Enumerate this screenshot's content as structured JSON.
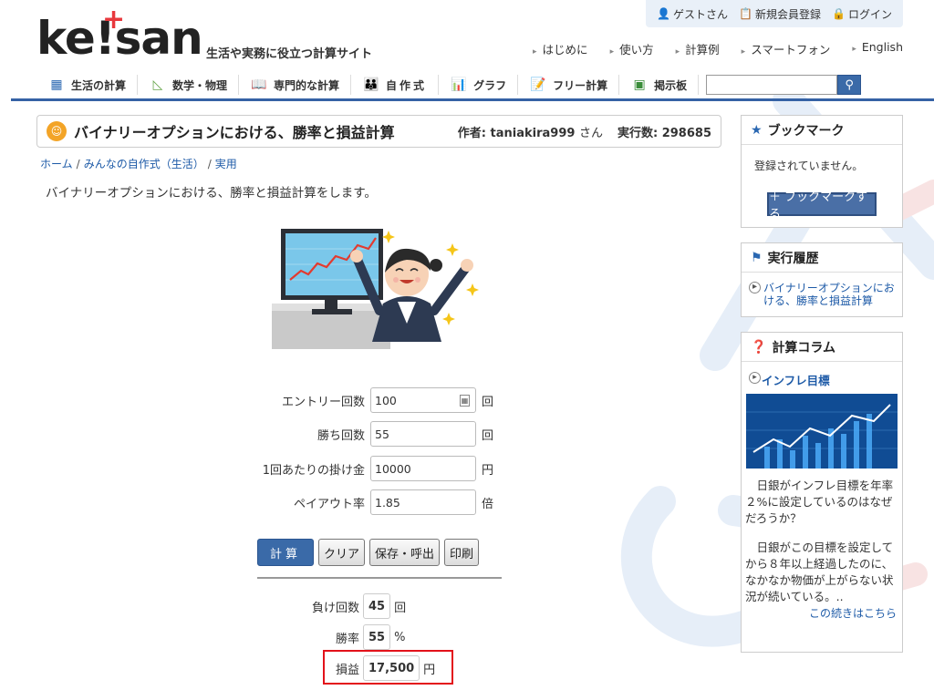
{
  "site": {
    "logo": "ke!san",
    "tagline": "生活や実務に役立つ計算サイト"
  },
  "account": {
    "guest": "ゲストさん",
    "register": "新規会員登録",
    "login": "ログイン"
  },
  "topnav": [
    "はじめに",
    "使い方",
    "計算例",
    "スマートフォン",
    "English"
  ],
  "mainnav": [
    {
      "label": "生活の計算",
      "icon": "calculator-icon"
    },
    {
      "label": "数学・物理",
      "icon": "ruler-triangle-icon"
    },
    {
      "label": "専門的な計算",
      "icon": "book-icon"
    },
    {
      "label": "自作式",
      "icon": "people-icon"
    },
    {
      "label": "グラフ",
      "icon": "bar-chart-icon"
    },
    {
      "label": "フリー計算",
      "icon": "memo-icon"
    },
    {
      "label": "掲示板",
      "icon": "board-icon"
    }
  ],
  "search": {
    "placeholder": ""
  },
  "page": {
    "title": "バイナリーオプションにおける、勝率と損益計算",
    "author_label": "作者:",
    "author": "taniakira999",
    "author_suffix": "さん",
    "exec_label": "実行数:",
    "exec_count": "298685",
    "breadcrumb": [
      "ホーム",
      "みんなの自作式（生活）",
      "実用"
    ],
    "description": "バイナリーオプションにおける、勝率と損益計算をします。"
  },
  "form": {
    "fields": [
      {
        "label": "エントリー回数",
        "value": "100",
        "unit": "回"
      },
      {
        "label": "勝ち回数",
        "value": "55",
        "unit": "回"
      },
      {
        "label": "1回あたりの掛け金",
        "value": "10000",
        "unit": "円"
      },
      {
        "label": "ペイアウト率",
        "value": "1.85",
        "unit": "倍"
      }
    ],
    "buttons": {
      "calc": "計算",
      "clear": "クリア",
      "save": "保存・呼出",
      "print": "印刷"
    }
  },
  "results": [
    {
      "label": "負け回数",
      "value": "45",
      "unit": "回"
    },
    {
      "label": "勝率",
      "value": "55",
      "unit": "%"
    },
    {
      "label": "損益",
      "value": "17,500",
      "unit": "円"
    }
  ],
  "sidebar": {
    "bookmark": {
      "title": "ブックマーク",
      "empty": "登録されていません。",
      "button": "＋ ブックマークする"
    },
    "history": {
      "title": "実行履歴",
      "item": "バイナリーオプションにおける、勝率と損益計算"
    },
    "column": {
      "title": "計算コラム",
      "link": "インフレ目標",
      "text1": "　日銀がインフレ目標を年率２%に設定しているのはなぜだろうか？",
      "text2": "　日銀がこの目標を設定してから８年以上経過したのに、なかなか物価が上がらない状況が続いている。..",
      "more": "この続きはこちら"
    }
  }
}
